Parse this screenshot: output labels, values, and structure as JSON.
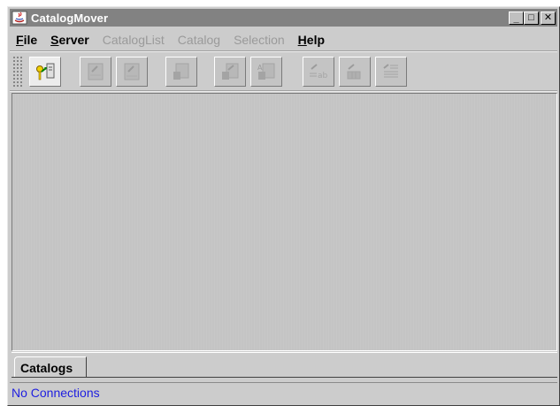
{
  "window": {
    "title": "CatalogMover"
  },
  "title_buttons": {
    "minimize": "_",
    "maximize": "□",
    "close": "✕"
  },
  "menu": [
    {
      "pre": "",
      "u": "F",
      "post": "ile",
      "enabled": true
    },
    {
      "pre": "",
      "u": "S",
      "post": "erver",
      "enabled": true
    },
    {
      "pre": "",
      "u": "",
      "post": "CatalogList",
      "enabled": false
    },
    {
      "pre": "",
      "u": "",
      "post": "Catalog",
      "enabled": false
    },
    {
      "pre": "",
      "u": "",
      "post": "Selection",
      "enabled": false
    },
    {
      "pre": "",
      "u": "H",
      "post": "elp",
      "enabled": true
    }
  ],
  "toolbar": [
    {
      "icon": "connect-server-icon",
      "enabled": true
    },
    {
      "icon": "import-catalog-icon",
      "enabled": false
    },
    {
      "icon": "export-catalog-icon",
      "enabled": false
    },
    {
      "icon": "delete-catalog-icon",
      "enabled": false
    },
    {
      "icon": "move-catalog-icon",
      "enabled": false
    },
    {
      "icon": "rename-catalog-icon",
      "enabled": false
    },
    {
      "icon": "catalog-text-icon",
      "enabled": false
    },
    {
      "icon": "catalog-grid-icon",
      "enabled": false
    },
    {
      "icon": "catalog-table-icon",
      "enabled": false
    }
  ],
  "tabs": [
    {
      "label": "Catalogs",
      "selected": true
    }
  ],
  "status": {
    "text": "No Connections"
  }
}
